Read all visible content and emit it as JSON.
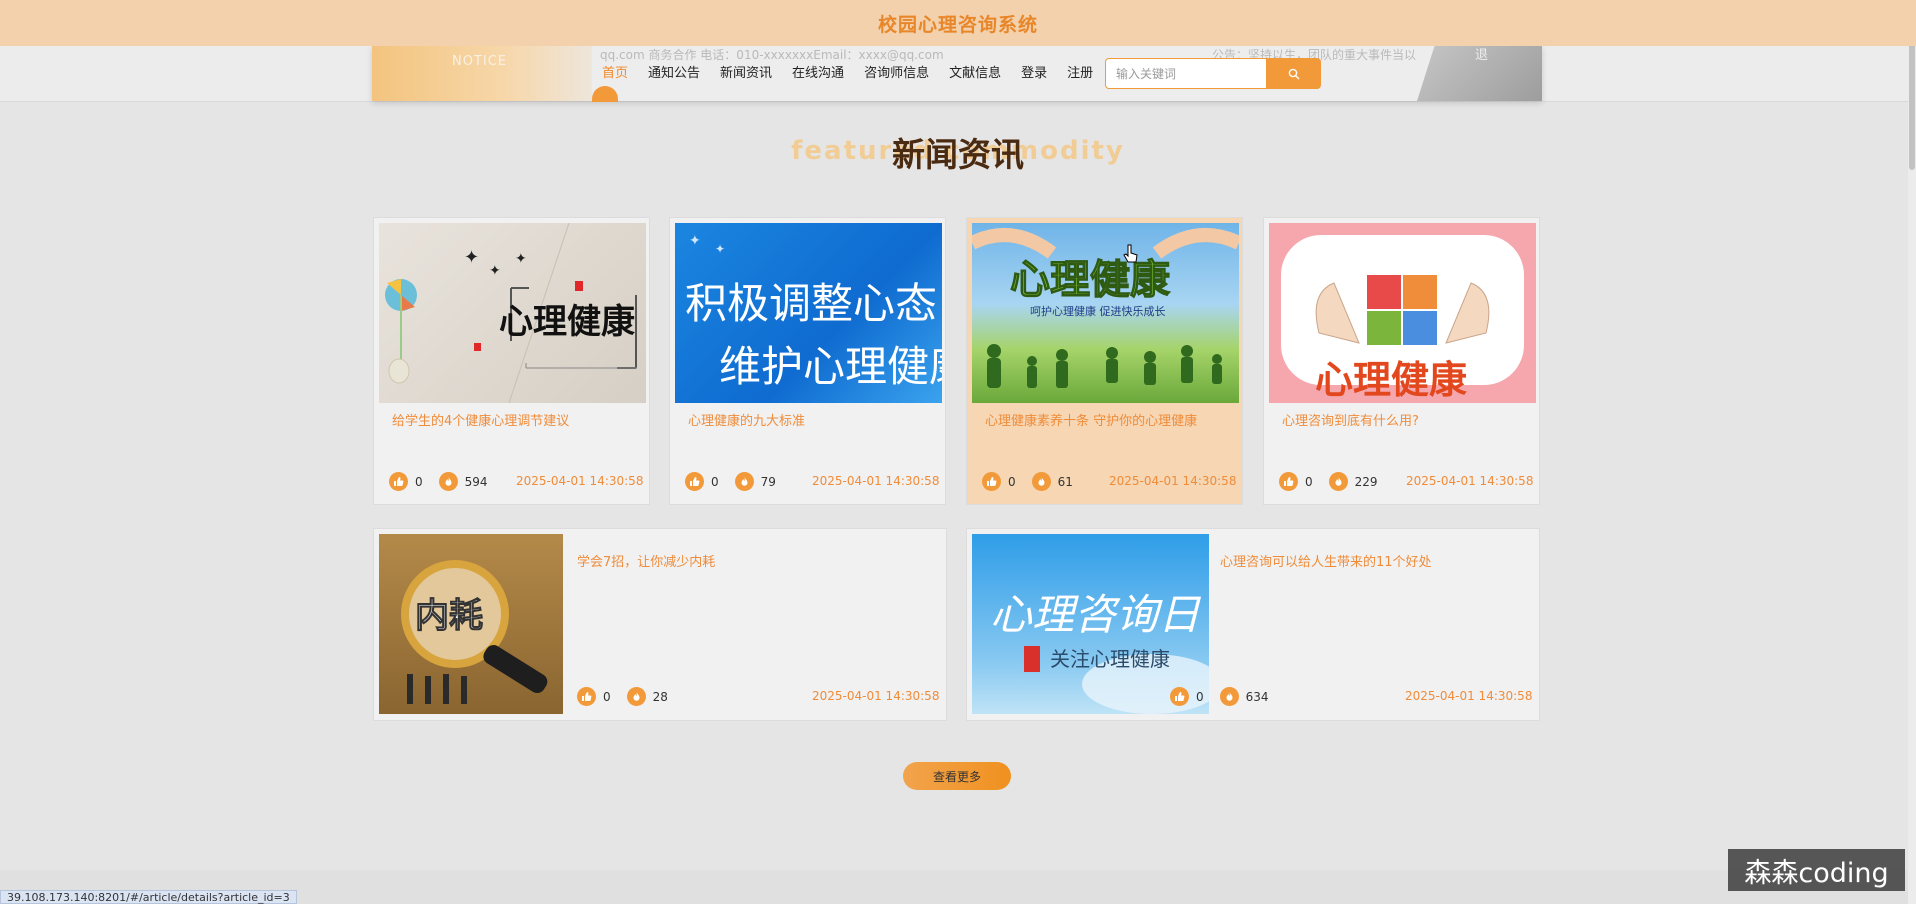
{
  "topbar": {
    "title": "校园心理咨询系统"
  },
  "header": {
    "notice_label": "NOTICE",
    "contact_line": "qq.com   商务合作  电话：010-xxxxxxxEmail：xxxx@qq.com",
    "announce_line": "公告：坚持以生，团队的重大事件当以",
    "corner_text": "退",
    "nav": [
      "首页",
      "通知公告",
      "新闻资讯",
      "在线沟通",
      "咨询师信息",
      "文献信息",
      "登录",
      "注册"
    ],
    "search_placeholder": "输入关键词"
  },
  "section": {
    "bg_text": "featured commodity",
    "title": "新闻资讯"
  },
  "articles": [
    {
      "title": "给学生的4个健康心理调节建议",
      "likes": "0",
      "views": "594",
      "date": "2025-04-01 14:30:58",
      "image_text": "心理健康"
    },
    {
      "title": "心理健康的九大标准",
      "likes": "0",
      "views": "79",
      "date": "2025-04-01 14:30:58",
      "image_text_1": "积极调整心态",
      "image_text_2": "维护心理健康"
    },
    {
      "title": "心理健康素养十条 守护你的心理健康",
      "likes": "0",
      "views": "61",
      "date": "2025-04-01 14:30:58",
      "image_text": "心理健康",
      "image_sub": "呵护心理健康 促进快乐成长"
    },
    {
      "title": "心理咨询到底有什么用?",
      "likes": "0",
      "views": "229",
      "date": "2025-04-01 14:30:58",
      "image_text": "心理健康"
    },
    {
      "title": "学会7招，让你减少内耗",
      "likes": "0",
      "views": "28",
      "date": "2025-04-01 14:30:58",
      "image_text": "内耗"
    },
    {
      "title": "心理咨询可以给人生带来的11个好处",
      "likes": "0",
      "views": "634",
      "date": "2025-04-01 14:30:58",
      "image_text": "心理咨询日",
      "image_sub": "关注心理健康"
    }
  ],
  "more_label": "查看更多",
  "status_url": "39.108.173.140:8201/#/article/details?article_id=3",
  "watermark": "森森coding",
  "colors": {
    "accent": "#f29a3a",
    "title_text": "#ef8c3a",
    "top_bar": "#f3d1ac"
  }
}
